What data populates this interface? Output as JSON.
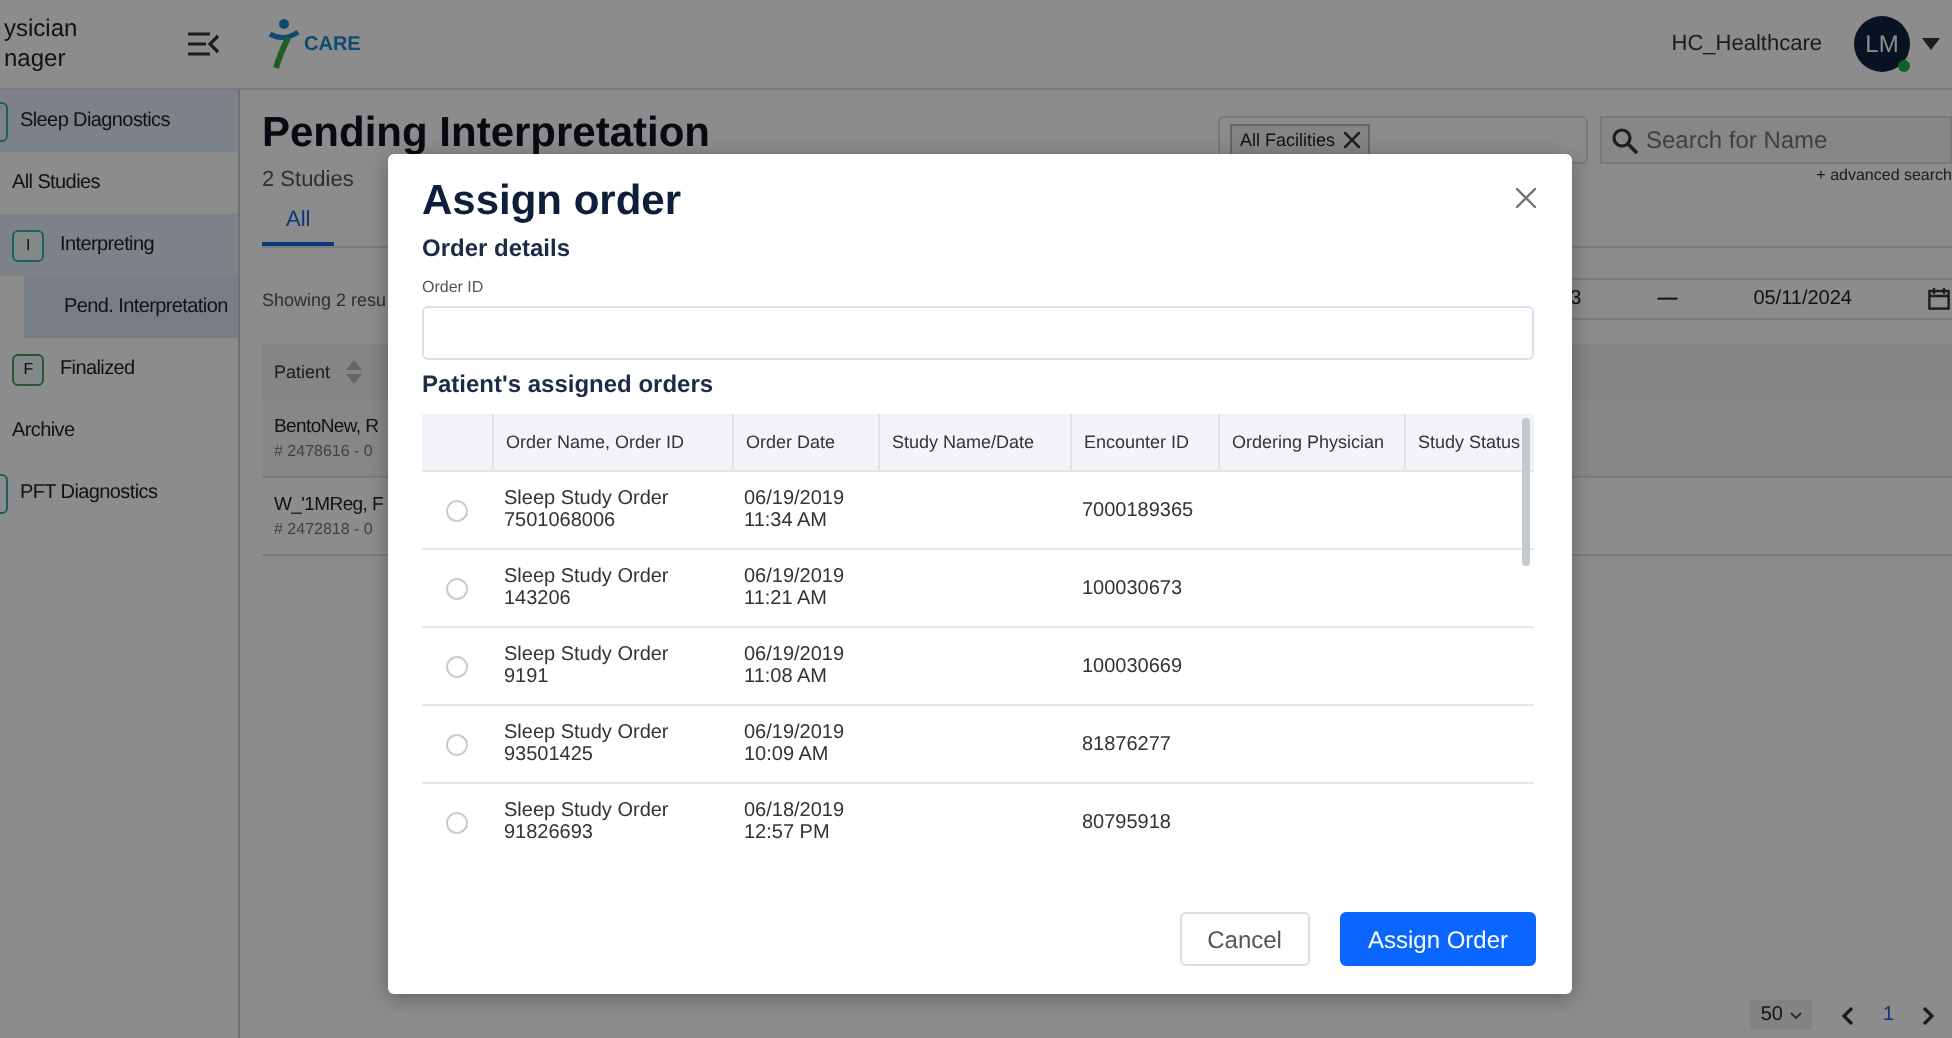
{
  "app": {
    "title_lines": [
      "ysician",
      "nager"
    ],
    "logo_text": "CARE",
    "org": "HC_Healthcare",
    "avatar_initials": "LM",
    "online": true
  },
  "sidebar": {
    "items": [
      {
        "kind": "section",
        "label": "Sleep Diagnostics",
        "selected": true
      },
      {
        "kind": "link",
        "label": "All Studies",
        "selected": false
      },
      {
        "kind": "group",
        "label": "Interpreting",
        "badge": "I",
        "selected": true
      },
      {
        "kind": "sub",
        "label": "Pend. Interpretation",
        "selected": true
      },
      {
        "kind": "group",
        "label": "Finalized",
        "badge": "F",
        "selected": false
      },
      {
        "kind": "link",
        "label": "Archive",
        "selected": false
      },
      {
        "kind": "section",
        "label": "PFT Diagnostics",
        "selected": false
      }
    ]
  },
  "page": {
    "title": "Pending Interpretation",
    "count": "2 Studies",
    "tabs": [
      {
        "label": "All",
        "selected": true
      }
    ],
    "facility_chip": "All Facilities",
    "search": {
      "placeholder": "Search for Name"
    },
    "advanced_search": "+ advanced search",
    "date_from": "3",
    "date_sep": "—",
    "date_to": "05/11/2024",
    "showing": "Showing 2 resu",
    "table": {
      "columns": [
        "Patient"
      ],
      "rows": [
        {
          "name": "BentoNew, R",
          "id": "# 2478616 - 0"
        },
        {
          "name": "W_'1MReg, F",
          "id": "# 2472818 - 0"
        }
      ]
    },
    "pagination": {
      "page_size": "50",
      "page": "1"
    }
  },
  "modal": {
    "title": "Assign order",
    "section": "Order details",
    "order_id": {
      "label": "Order ID"
    },
    "orders_title": "Patient's assigned orders",
    "columns": [
      "Order Name, Order ID",
      "Order Date",
      "Study Name/Date",
      "Encounter ID",
      "Ordering Physician",
      "Study Status"
    ],
    "rows": [
      {
        "selected": false,
        "order_name": "Sleep Study Order",
        "order_id": "7501068006",
        "date": "06/19/2019",
        "time": "11:34 AM",
        "encounter_id": "7000189365"
      },
      {
        "selected": false,
        "order_name": "Sleep Study Order",
        "order_id": "143206",
        "date": "06/19/2019",
        "time": "11:21 AM",
        "encounter_id": "100030673"
      },
      {
        "selected": false,
        "order_name": "Sleep Study Order",
        "order_id": "9191",
        "date": "06/19/2019",
        "time": "11:08 AM",
        "encounter_id": "100030669"
      },
      {
        "selected": false,
        "order_name": "Sleep Study Order",
        "order_id": "93501425",
        "date": "06/19/2019",
        "time": "10:09 AM",
        "encounter_id": "81876277"
      },
      {
        "selected": false,
        "order_name": "Sleep Study Order",
        "order_id": "91826693",
        "date": "06/18/2019",
        "time": "12:57 PM",
        "encounter_id": "80795918"
      }
    ],
    "buttons": {
      "cancel": "Cancel",
      "confirm": "Assign Order"
    }
  }
}
